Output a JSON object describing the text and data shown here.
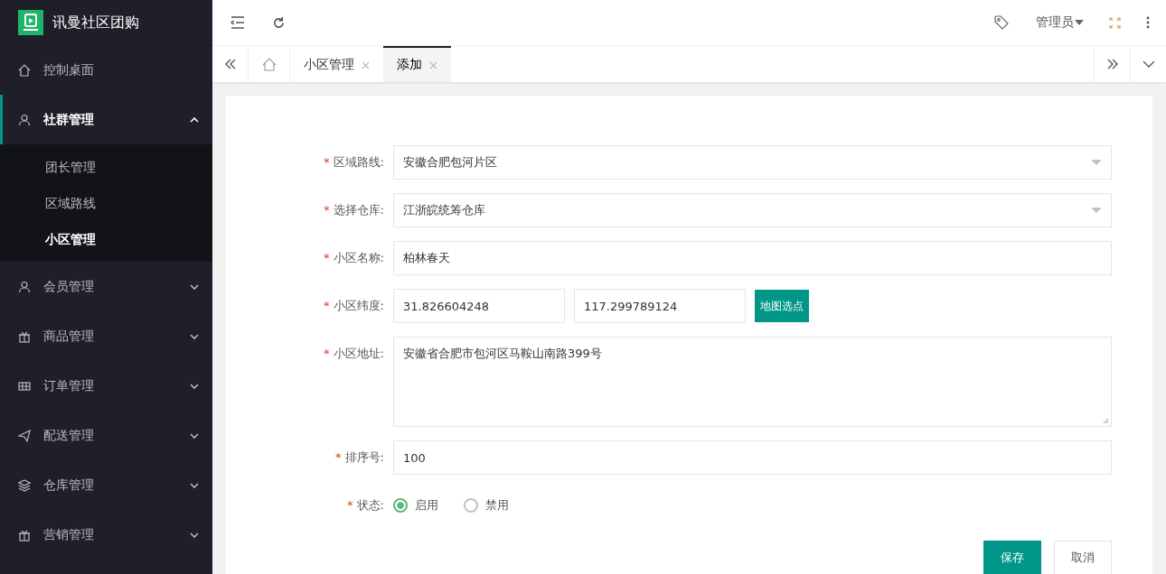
{
  "sidebar": {
    "logo_text": "讯曼社区团购",
    "items": [
      {
        "label": "控制桌面",
        "selected": false
      },
      {
        "label": "社群管理",
        "selected": true,
        "expanded": true,
        "children": [
          {
            "label": "团长管理",
            "selected": false
          },
          {
            "label": "区域路线",
            "selected": false
          },
          {
            "label": "小区管理",
            "selected": true
          }
        ]
      },
      {
        "label": "会员管理",
        "selected": false,
        "expanded": false
      },
      {
        "label": "商品管理",
        "selected": false,
        "expanded": false
      },
      {
        "label": "订单管理",
        "selected": false,
        "expanded": false
      },
      {
        "label": "配送管理",
        "selected": false,
        "expanded": false
      },
      {
        "label": "仓库管理",
        "selected": false,
        "expanded": false
      },
      {
        "label": "营销管理",
        "selected": false,
        "expanded": false
      }
    ]
  },
  "header": {
    "user": "管理员"
  },
  "tabs": [
    {
      "label": "小区管理",
      "selected": false
    },
    {
      "label": "添加",
      "selected": true
    }
  ],
  "form": {
    "fields": [
      {
        "kind": "select",
        "mark": "*",
        "label": "区域路线:",
        "value": "安徽合肥包河片区"
      },
      {
        "kind": "select",
        "mark": "*",
        "label": "选择仓库:",
        "value": "江浙皖统筹仓库"
      },
      {
        "kind": "text",
        "mark": "*",
        "label": "小区名称:",
        "value": "柏林春天"
      },
      {
        "kind": "coords",
        "mark": "*",
        "label": "小区纬度:",
        "values": [
          "31.826604248",
          "117.299789124"
        ],
        "button": "地图选点"
      },
      {
        "kind": "textarea",
        "mark": "*",
        "label": "小区地址:",
        "value": "安徽省合肥市包河区马鞍山南路399号"
      },
      {
        "kind": "text",
        "mark": "*",
        "label": "排序号:",
        "value": "100"
      },
      {
        "kind": "radio",
        "mark": "*",
        "label": "状态:",
        "options": [
          {
            "label": "启用",
            "selected": true
          },
          {
            "label": "禁用",
            "selected": false
          }
        ]
      }
    ],
    "buttons": [
      {
        "kind": "primary",
        "label": "保存"
      },
      {
        "kind": "default",
        "label": "取消"
      }
    ]
  }
}
